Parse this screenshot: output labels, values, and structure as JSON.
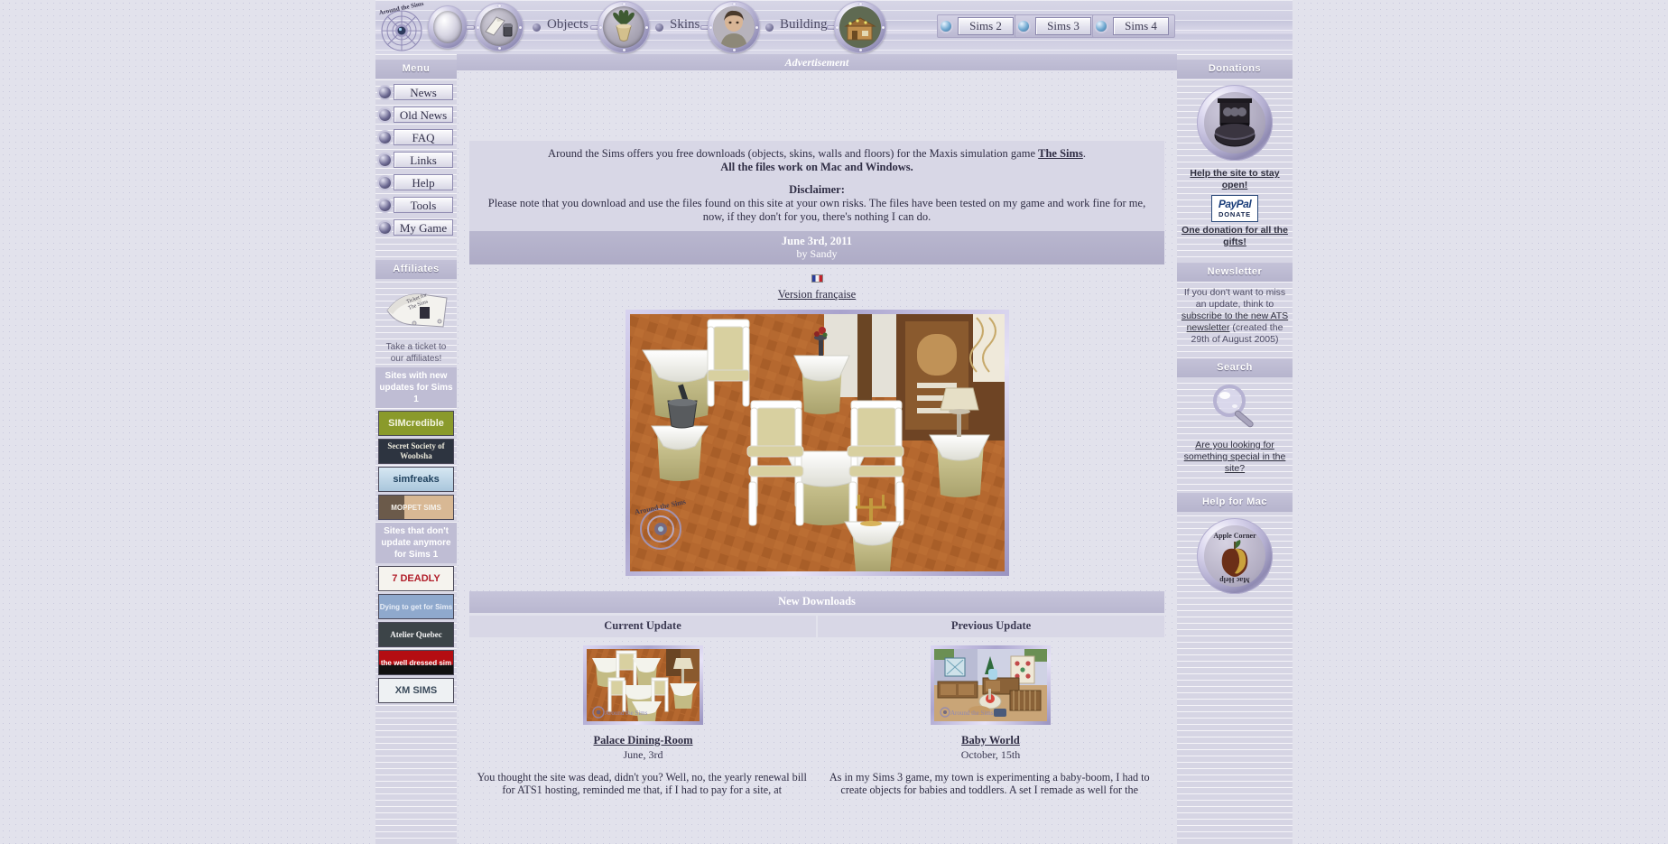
{
  "site": {
    "logo_text": "Around the Sims"
  },
  "header": {
    "nav": [
      {
        "label": "Objects",
        "icon": "plant-porthole-icon"
      },
      {
        "label": "Skins",
        "icon": "person-porthole-icon"
      },
      {
        "label": "Building",
        "icon": "house-porthole-icon"
      }
    ],
    "sims_buttons": [
      "Sims 2",
      "Sims 3",
      "Sims 4"
    ]
  },
  "left_sidebar": {
    "menu_title": "Menu",
    "menu_items": [
      "News",
      "Old News",
      "FAQ",
      "Links",
      "Help",
      "Tools",
      "My Game"
    ],
    "affiliates_title": "Affiliates",
    "ticket_caption": "Take a ticket to our affiliates!",
    "group_updating": "Sites with new updates for Sims 1",
    "group_not_updating": "Sites that don't update anymore for Sims 1",
    "affiliates_updating": [
      {
        "name": "SIMcredible",
        "bg": "#8a9a2b",
        "fg": "#f2f4df"
      },
      {
        "name": "Secret Society of Woobsha",
        "bg": "#2d3440",
        "fg": "#e8e6d8"
      },
      {
        "name": "simfreaks",
        "bg": "#bcd6e6",
        "fg": "#1d3f5c"
      },
      {
        "name": "MOPPET SIMS",
        "bg": "#c8a183",
        "fg": "#2a2018"
      }
    ],
    "affiliates_inactive": [
      {
        "name": "7 DEADLY",
        "bg": "#f5f3ee",
        "fg": "#b11e2a"
      },
      {
        "name": "Dying to get for Sims",
        "bg": "#8fa9cd",
        "fg": "#e9eef7"
      },
      {
        "name": "Atelier Quebec",
        "bg": "#3c4448",
        "fg": "#f3f3f3"
      },
      {
        "name": "the well dressed sim",
        "bg": "#b40d12",
        "fg": "#ffffff"
      },
      {
        "name": "XM SIMS",
        "bg": "#eef1f3",
        "fg": "#3a4a5a"
      }
    ]
  },
  "main": {
    "ad_label": "Advertisement",
    "intro_line1_pre": "Around the Sims offers you free downloads (objects, skins, walls and floors) for the Maxis simulation game ",
    "intro_link": "The Sims",
    "intro_line1_post": ".",
    "intro_line2": "All the files work on Mac and Windows.",
    "disclaimer_title": "Disclaimer:",
    "disclaimer_body": "Please note that you download and use the files found on this site at your own risks. The files have been tested on my game and work fine for me, now, if they don't for you, there's nothing I can do.",
    "update_date": "June 3rd, 2011",
    "update_author": "by Sandy",
    "french_link": "Version française",
    "hero_alt": "Palace dining room with draped tables and gilded chairs",
    "new_downloads_title": "New Downloads",
    "columns": [
      {
        "head": "Current Update",
        "title": "Palace Dining-Room",
        "date": "June, 3rd",
        "paragraph": "You thought the site was dead, didn't you? Well, no, the yearly renewal bill for ATS1 hosting, reminded me that, if I had to pay for a site, at"
      },
      {
        "head": "Previous Update",
        "title": "Baby World",
        "date": "October, 15th",
        "paragraph": "As in my Sims 3 game, my town is experimenting a baby-boom, I had to create objects for babies and toddlers. A set I remade as well for the"
      }
    ]
  },
  "right_sidebar": {
    "donations_title": "Donations",
    "donations_link": "Help the site to stay open!",
    "paypal_top": "PayPal",
    "paypal_bottom": "DONATE",
    "donations_note": "One donation for all the gifts!",
    "newsletter_title": "Newsletter",
    "newsletter_text_pre": "If you don't want to miss an update, think to ",
    "newsletter_link": "subscribe to the new ATS newsletter",
    "newsletter_text_post": " (created the 29th of August 2005)",
    "search_title": "Search",
    "search_link": "Are you looking for something special in the site?",
    "mac_title": "Help for Mac",
    "mac_badge_top": "Apple Corner",
    "mac_badge_bottom": "Mac Help"
  },
  "colors": {
    "page_bg": "#e2e2ec",
    "accent": "#b6b4cd",
    "sidebar": "#d6d5e4",
    "panel": "#d8d7e6"
  }
}
